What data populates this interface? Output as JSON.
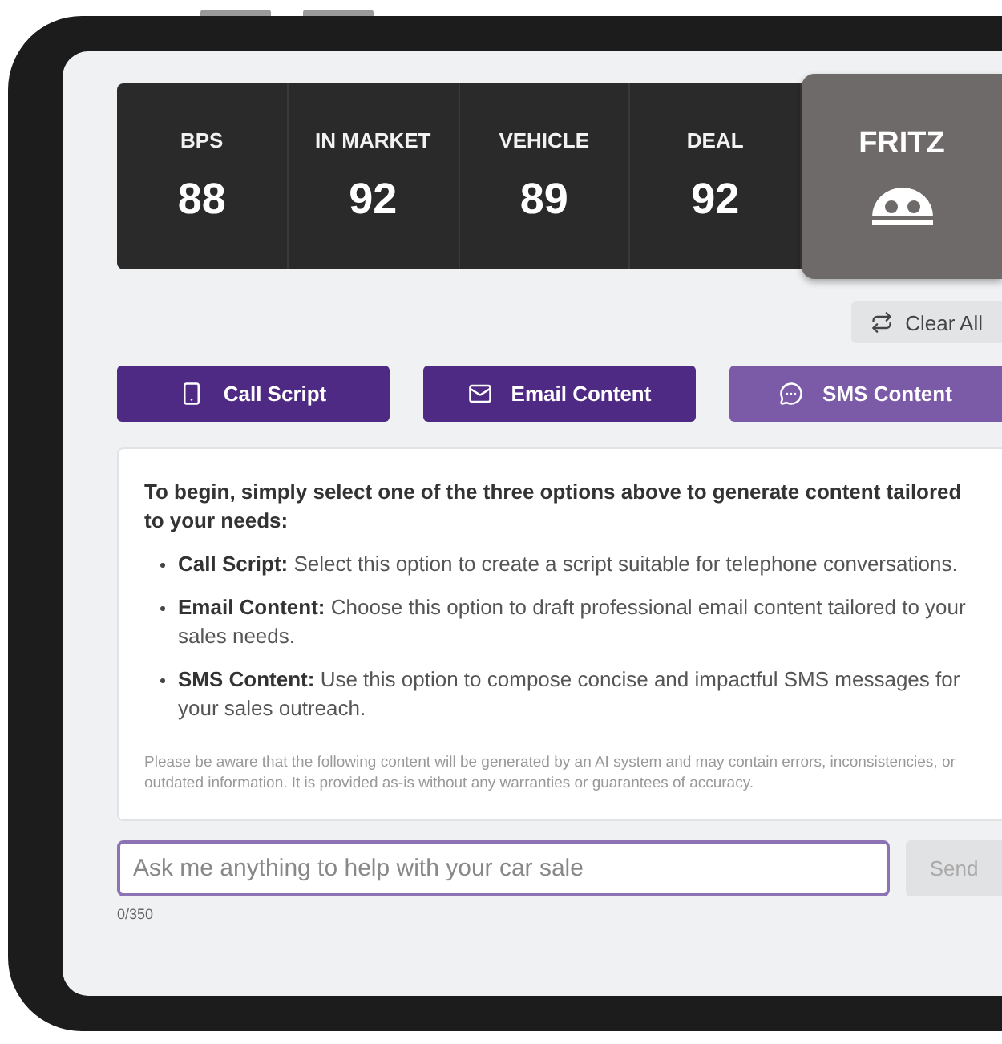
{
  "stats": [
    {
      "label": "BPS",
      "value": "88"
    },
    {
      "label": "IN MARKET",
      "value": "92"
    },
    {
      "label": "VEHICLE",
      "value": "89"
    },
    {
      "label": "DEAL",
      "value": "92"
    }
  ],
  "assistant": {
    "label": "FRITZ"
  },
  "clear_button": "Clear All",
  "mode_buttons": [
    {
      "label": "Call Script",
      "kind": "phone"
    },
    {
      "label": "Email Content",
      "kind": "email"
    },
    {
      "label": "SMS Content",
      "kind": "chat"
    }
  ],
  "intro": "To begin, simply select one of the three options above to generate content tailored to your needs:",
  "options": [
    "**Call Script:** Select this option to create a script suitable for telephone conversations.",
    "**Email Content:** Choose this option to draft professional email content tailored to your sales needs.",
    "**SMS Content:** Use this option to compose concise and impactful SMS messages for your sales outreach."
  ],
  "disclaimer": "Please be aware that the following content will be generated by an AI system and may contain errors, inconsistencies, or outdated information. It is provided as-is without any warranties or guarantees of accuracy.",
  "input": {
    "placeholder": "Ask me anything to help with your car sale",
    "counter": "0/350"
  },
  "send_button": "Send"
}
